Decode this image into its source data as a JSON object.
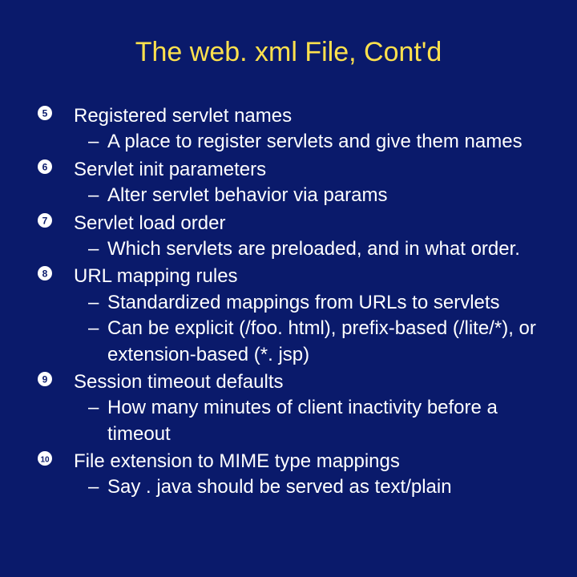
{
  "title": "The web. xml File, Cont'd",
  "bullets": [
    "➎",
    "➏",
    "➐",
    "➑",
    "➒",
    "➓"
  ],
  "items": [
    {
      "title": "Registered servlet names",
      "subs": [
        "A place to register servlets and give them names"
      ]
    },
    {
      "title": "Servlet init parameters",
      "subs": [
        "Alter servlet behavior via params"
      ]
    },
    {
      "title": "Servlet load order",
      "subs": [
        "Which servlets are preloaded, and in what order."
      ]
    },
    {
      "title": "URL mapping rules",
      "subs": [
        "Standardized mappings from URLs to servlets",
        "Can be explicit (/foo. html), prefix-based (/lite/*), or extension-based (*. jsp)"
      ]
    },
    {
      "title": "Session timeout defaults",
      "subs": [
        "How many minutes of client inactivity before a timeout"
      ]
    },
    {
      "title": "File extension to MIME type mappings",
      "subs": [
        "Say . java should be served as text/plain"
      ]
    }
  ]
}
